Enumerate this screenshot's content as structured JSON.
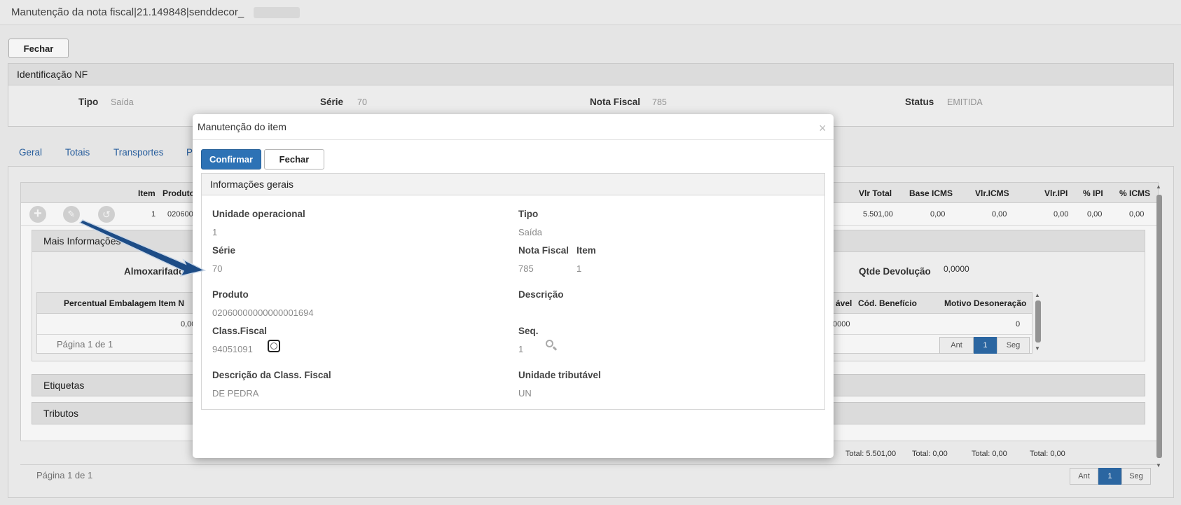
{
  "window": {
    "title": "Manutenção da nota fiscal|21.149848|senddecor_"
  },
  "toolbar": {
    "close_label": "Fechar"
  },
  "identification": {
    "title": "Identificação NF",
    "fields": [
      {
        "label": "Tipo",
        "value": "Saída"
      },
      {
        "label": "Série",
        "value": "70"
      },
      {
        "label": "Nota Fiscal",
        "value": "785"
      },
      {
        "label": "Status",
        "value": "EMITIDA"
      }
    ]
  },
  "tabs": [
    "Geral",
    "Totais",
    "Transportes",
    "P"
  ],
  "items_table": {
    "headers_left": [
      "Item",
      "Produto"
    ],
    "headers_right": [
      "Vlr Total",
      "Base ICMS",
      "Vlr.ICMS",
      "Vlr.IPI",
      "% IPI",
      "% ICMS"
    ],
    "row": {
      "item": "1",
      "product_partial": "0206000",
      "values": [
        "5.501,00",
        "0,00",
        "0,00",
        "0,00",
        "0,00",
        "0,00"
      ]
    },
    "totals": [
      "Total: 5.501,00",
      "Total: 0,00",
      "Total: 0,00",
      "Total: 0,00"
    ],
    "pager": {
      "label": "Página 1 de 1",
      "prev": "Ant",
      "page": "1",
      "next": "Seg"
    }
  },
  "more_info": {
    "title": "Mais Informações",
    "almoxarifado_label": "Almoxarifado",
    "qtde_devolucao_label": "Qtde Devolução",
    "qtde_devolucao_value": "0,0000",
    "subtable": {
      "header_left": "Percentual Embalagem Item N",
      "headers_right": [
        "ável",
        "Cód. Benefício",
        "Motivo Desoneração"
      ],
      "row_left": "0,00",
      "row_mid": "0000",
      "row_right": "0"
    },
    "pager": {
      "label": "Página 1 de 1",
      "prev": "Ant",
      "page": "1",
      "next": "Seg"
    }
  },
  "sections": {
    "labels": "Etiquetas",
    "taxes": "Tributos"
  },
  "modal": {
    "title": "Manutenção do item",
    "close_symbol": "×",
    "confirm_label": "Confirmar",
    "close_label": "Fechar",
    "section_title": "Informações gerais",
    "fields": {
      "unidade_operacional": {
        "label": "Unidade operacional",
        "value": "1"
      },
      "tipo": {
        "label": "Tipo",
        "value": "Saída"
      },
      "serie": {
        "label": "Série",
        "value": "70"
      },
      "nota_fiscal": {
        "label": "Nota Fiscal",
        "value": "785"
      },
      "item": {
        "label": "Item",
        "value": "1"
      },
      "produto": {
        "label": "Produto",
        "value": "02060000000000001694"
      },
      "descricao": {
        "label": "Descrição",
        "value": ""
      },
      "class_fiscal": {
        "label": "Class.Fiscal",
        "value": "94051091"
      },
      "seq": {
        "label": "Seq.",
        "value": "1"
      },
      "descricao_class_fiscal": {
        "label": "Descrição da Class. Fiscal",
        "value": "DE PEDRA"
      },
      "unidade_tributavel": {
        "label": "Unidade tributável",
        "value": "UN"
      }
    }
  },
  "colors": {
    "primary": "#2d72b5",
    "link": "#2a62a4",
    "arrow": "#1d4c86"
  }
}
